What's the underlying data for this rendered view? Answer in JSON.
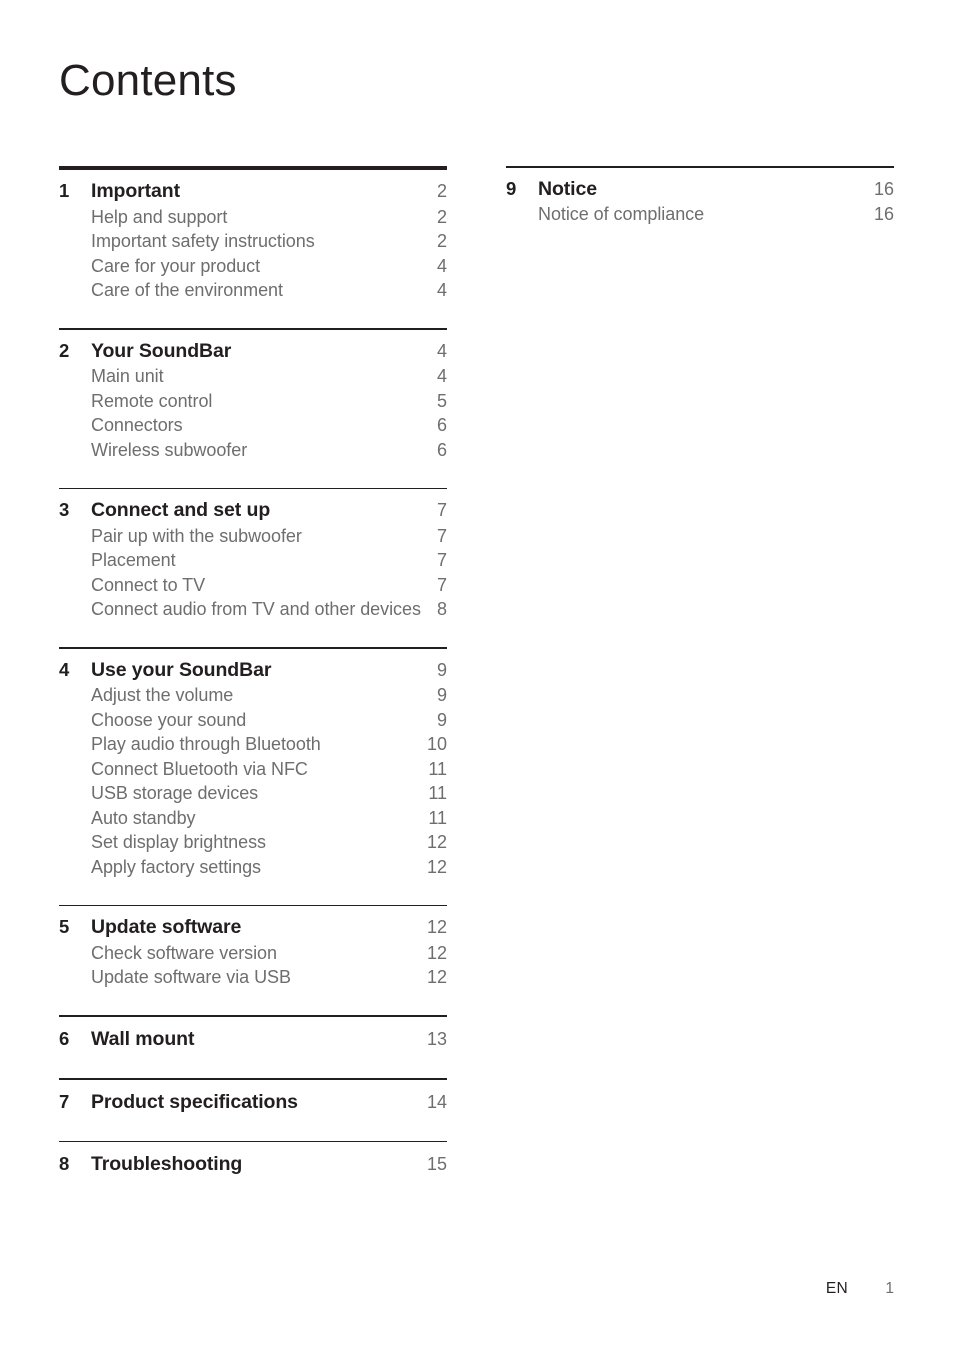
{
  "document": {
    "title": "Contents"
  },
  "columns": {
    "left": {
      "top_rule": "thick",
      "chapters": [
        {
          "number": "1",
          "title": "Important",
          "page": "2",
          "entries": [
            {
              "label": "Help and support",
              "page": "2"
            },
            {
              "label": "Important safety instructions",
              "page": "2"
            },
            {
              "label": "Care for your product",
              "page": "4"
            },
            {
              "label": "Care of the environment",
              "page": "4"
            }
          ]
        },
        {
          "number": "2",
          "title": "Your SoundBar",
          "page": "4",
          "entries": [
            {
              "label": "Main unit",
              "page": "4"
            },
            {
              "label": "Remote control",
              "page": "5"
            },
            {
              "label": "Connectors",
              "page": "6"
            },
            {
              "label": "Wireless subwoofer",
              "page": "6"
            }
          ]
        },
        {
          "number": "3",
          "title": "Connect and set up",
          "page": "7",
          "entries": [
            {
              "label": "Pair up with the subwoofer",
              "page": "7"
            },
            {
              "label": "Placement",
              "page": "7"
            },
            {
              "label": "Connect to TV",
              "page": "7"
            },
            {
              "label": "Connect audio from TV and other devices",
              "page": "8"
            }
          ]
        },
        {
          "number": "4",
          "title": "Use your SoundBar",
          "page": "9",
          "entries": [
            {
              "label": "Adjust the volume",
              "page": "9"
            },
            {
              "label": "Choose your sound",
              "page": "9"
            },
            {
              "label": "Play audio through Bluetooth",
              "page": "10"
            },
            {
              "label": "Connect Bluetooth via NFC",
              "page": "11"
            },
            {
              "label": "USB storage devices",
              "page": "11"
            },
            {
              "label": "Auto standby",
              "page": "11"
            },
            {
              "label": "Set display brightness",
              "page": "12"
            },
            {
              "label": "Apply factory settings",
              "page": "12"
            }
          ]
        },
        {
          "number": "5",
          "title": "Update software",
          "page": "12",
          "entries": [
            {
              "label": "Check software version",
              "page": "12"
            },
            {
              "label": "Update software via USB",
              "page": "12"
            }
          ]
        },
        {
          "number": "6",
          "title": "Wall mount",
          "page": "13",
          "entries": []
        },
        {
          "number": "7",
          "title": "Product specifications",
          "page": "14",
          "entries": []
        },
        {
          "number": "8",
          "title": "Troubleshooting",
          "page": "15",
          "entries": []
        }
      ]
    },
    "right": {
      "top_rule": "thin",
      "chapters": [
        {
          "number": "9",
          "title": "Notice",
          "page": "16",
          "entries": [
            {
              "label": "Notice of compliance",
              "page": "16"
            }
          ]
        }
      ]
    }
  },
  "footer": {
    "language": "EN",
    "page_number": "1"
  },
  "colors": {
    "text_dark": "#231f20",
    "text_gray": "#6e6e6e",
    "rule": "#231f20",
    "background": "#ffffff"
  }
}
